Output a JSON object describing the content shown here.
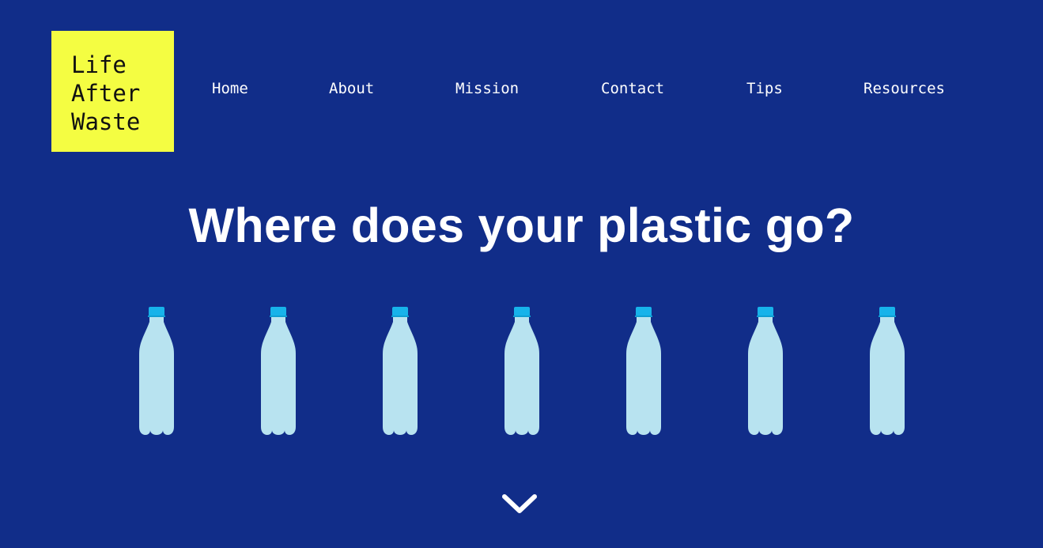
{
  "logo": {
    "line1": "Life",
    "line2": "After",
    "line3": "Waste"
  },
  "nav": {
    "items": [
      {
        "label": "Home"
      },
      {
        "label": "About"
      },
      {
        "label": "Mission"
      },
      {
        "label": "Contact"
      },
      {
        "label": "Tips"
      },
      {
        "label": "Resources"
      }
    ]
  },
  "hero": {
    "headline": "Where does your plastic go?",
    "bottle_count": 7,
    "bottle_icon": "plastic-bottle-icon",
    "scroll_icon": "chevron-down-icon"
  },
  "colors": {
    "background": "#112d89",
    "logo_background": "#f4fd42",
    "bottle_body": "#b8e3f0",
    "bottle_cap": "#17b3ea",
    "text": "#ffffff"
  }
}
